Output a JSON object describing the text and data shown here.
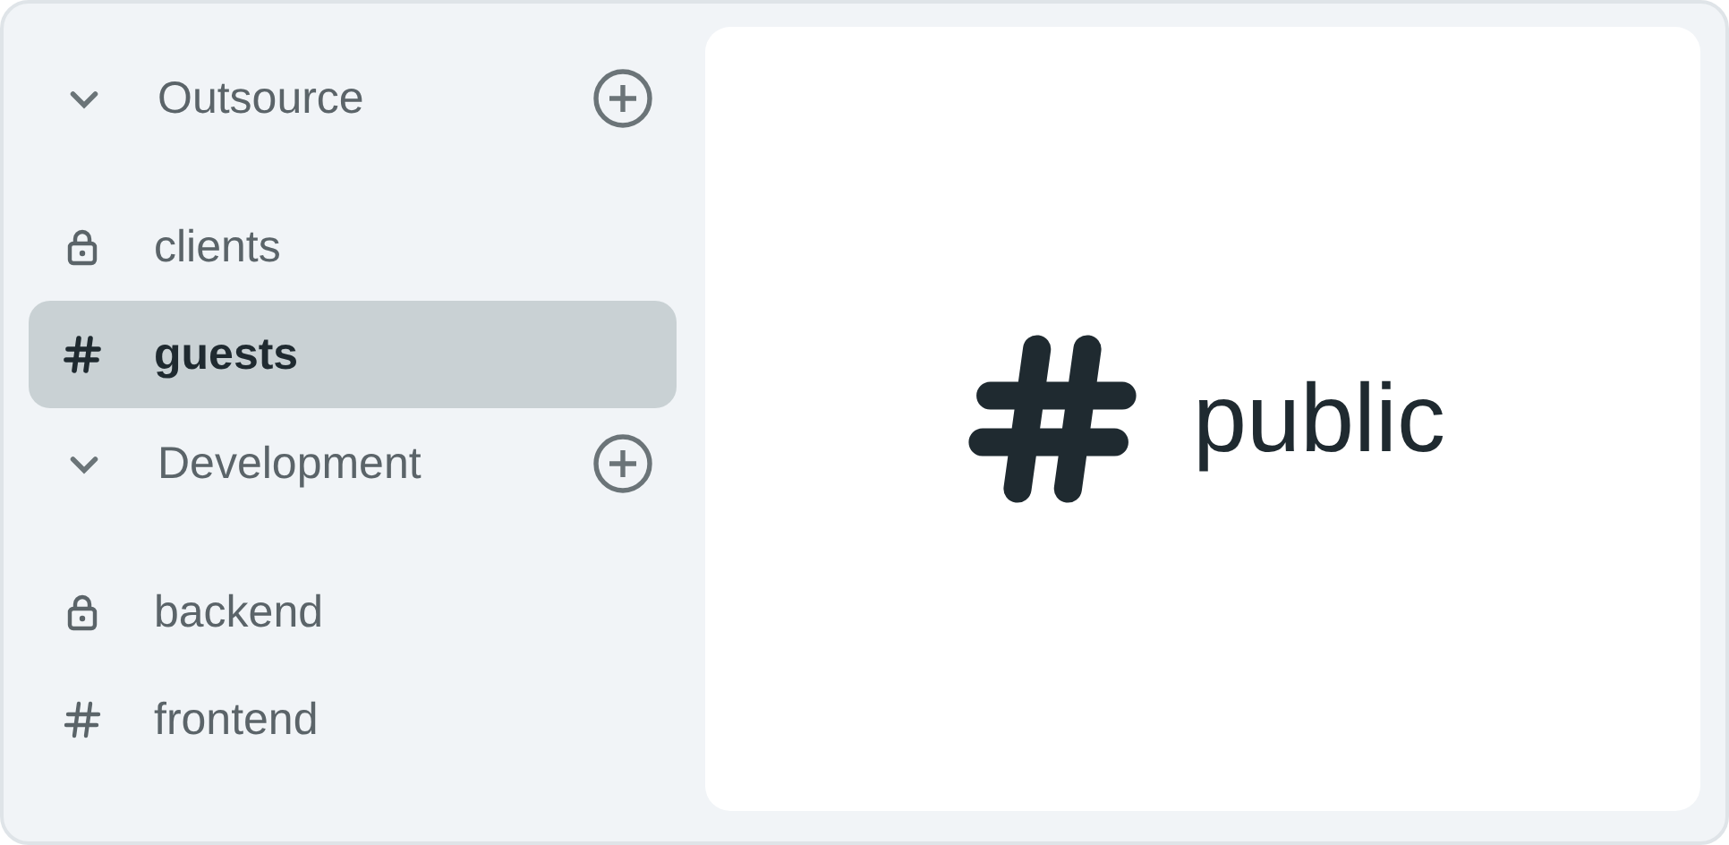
{
  "sidebar": {
    "groups": [
      {
        "name": "Outsource",
        "expanded": true,
        "channels": [
          {
            "name": "clients",
            "kind": "private",
            "selected": false
          },
          {
            "name": "guests",
            "kind": "public",
            "selected": true
          }
        ]
      },
      {
        "name": "Development",
        "expanded": true,
        "channels": [
          {
            "name": "backend",
            "kind": "private",
            "selected": false
          },
          {
            "name": "frontend",
            "kind": "public",
            "selected": false
          }
        ]
      }
    ]
  },
  "main": {
    "channel": {
      "name": "public",
      "kind": "public"
    }
  }
}
